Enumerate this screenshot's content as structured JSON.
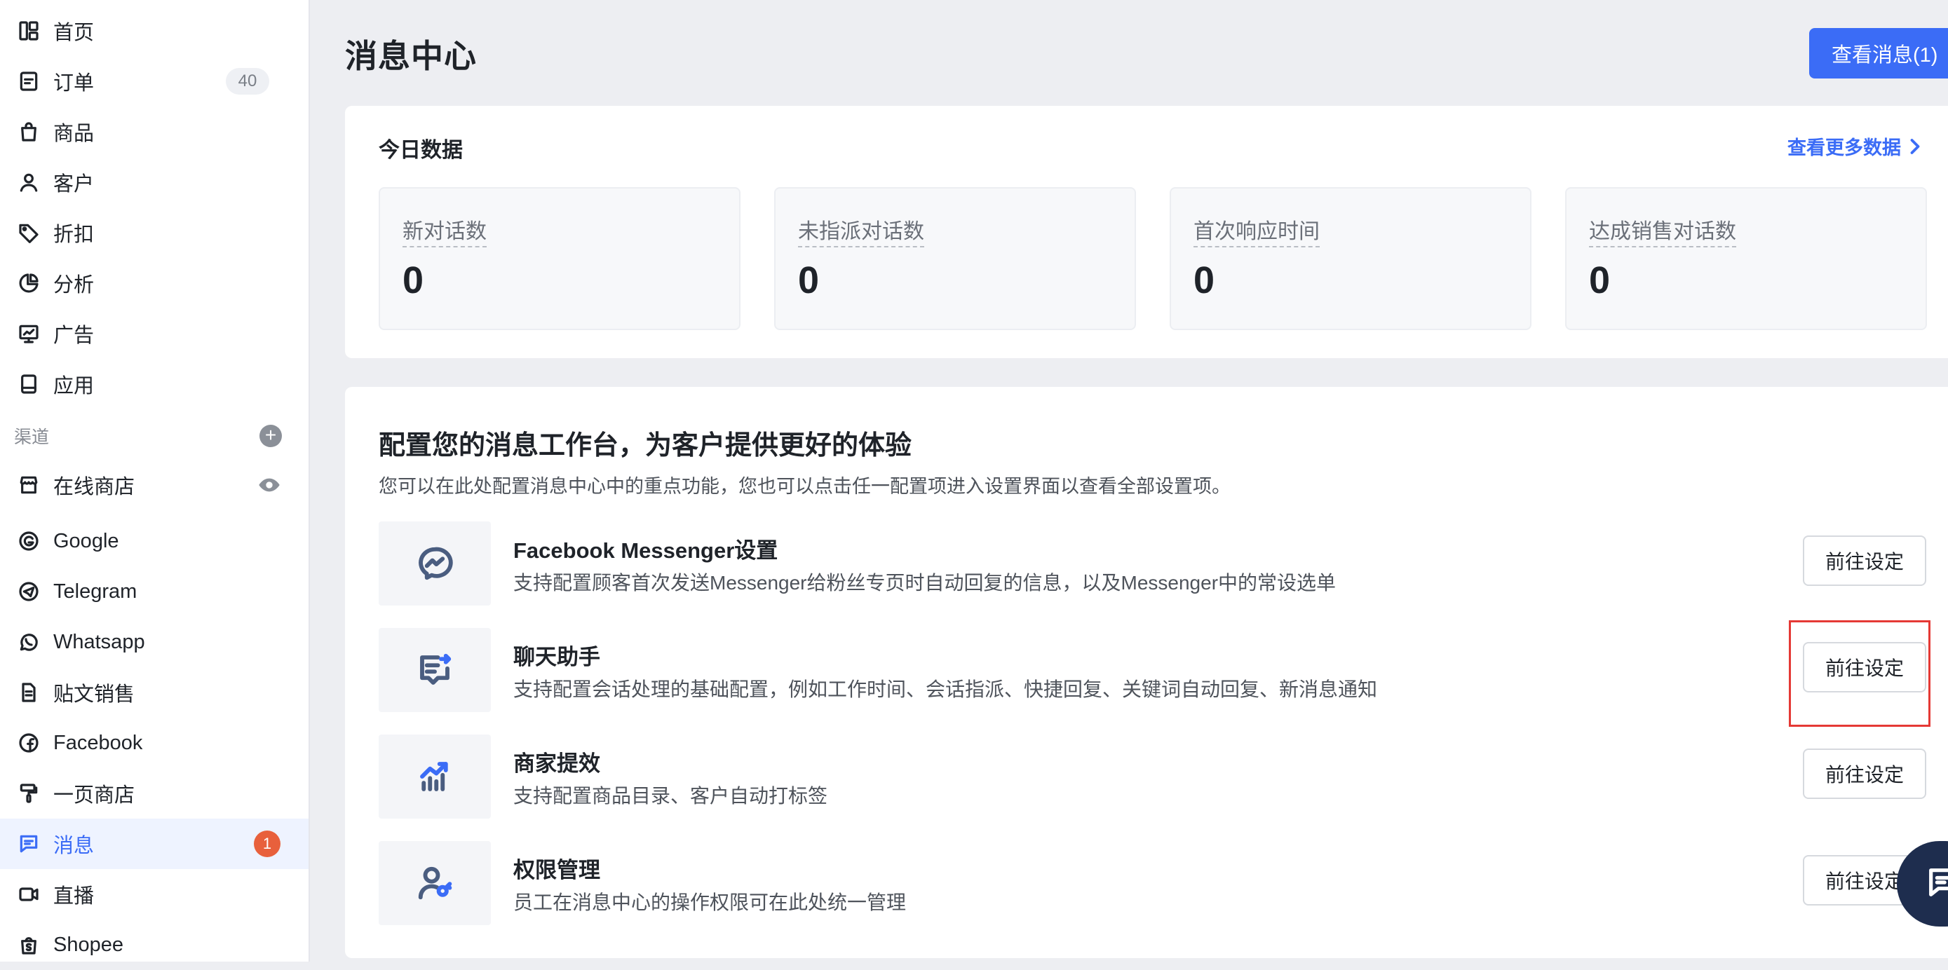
{
  "sidebar": {
    "items": [
      {
        "label": "首页",
        "icon": "dashboard-icon"
      },
      {
        "label": "订单",
        "icon": "order-icon",
        "count": "40"
      },
      {
        "label": "商品",
        "icon": "bag-icon"
      },
      {
        "label": "客户",
        "icon": "user-icon"
      },
      {
        "label": "折扣",
        "icon": "tag-icon"
      },
      {
        "label": "分析",
        "icon": "pie-chart-icon"
      },
      {
        "label": "广告",
        "icon": "monitor-icon"
      },
      {
        "label": "应用",
        "icon": "app-icon"
      }
    ],
    "section_label": "渠道",
    "channels": [
      {
        "label": "在线商店",
        "icon": "store-icon"
      },
      {
        "label": "Google",
        "icon": "google-icon"
      },
      {
        "label": "Telegram",
        "icon": "telegram-icon"
      },
      {
        "label": "Whatsapp",
        "icon": "whatsapp-icon"
      },
      {
        "label": "贴文销售",
        "icon": "document-icon"
      },
      {
        "label": "Facebook",
        "icon": "facebook-icon"
      },
      {
        "label": "一页商店",
        "icon": "brush-icon"
      },
      {
        "label": "消息",
        "icon": "message-icon",
        "badge": "1",
        "active": true
      },
      {
        "label": "直播",
        "icon": "video-icon"
      },
      {
        "label": "Shopee",
        "icon": "shopee-icon"
      }
    ]
  },
  "header": {
    "title": "消息中心",
    "view_messages_label": "查看消息(1)"
  },
  "today": {
    "title": "今日数据",
    "more_link": "查看更多数据",
    "stats": [
      {
        "label": "新对话数",
        "value": "0"
      },
      {
        "label": "未指派对话数",
        "value": "0"
      },
      {
        "label": "首次响应时间",
        "value": "0"
      },
      {
        "label": "达成销售对话数",
        "value": "0"
      }
    ]
  },
  "config": {
    "title": "配置您的消息工作台，为客户提供更好的体验",
    "description": "您可以在此处配置消息中心中的重点功能，您也可以点击任一配置项进入设置界面以查看全部设置项。",
    "items": [
      {
        "name": "Facebook Messenger设置",
        "desc": "支持配置顾客首次发送Messenger给粉丝专页时自动回复的信息，以及Messenger中的常设选单",
        "button": "前往设定",
        "icon": "messenger-icon"
      },
      {
        "name": "聊天助手",
        "desc": "支持配置会话处理的基础配置，例如工作时间、会话指派、快捷回复、关键词自动回复、新消息通知",
        "button": "前往设定",
        "icon": "chat-assistant-icon"
      },
      {
        "name": "商家提效",
        "desc": "支持配置商品目录、客户自动打标签",
        "button": "前往设定",
        "icon": "growth-chart-icon"
      },
      {
        "name": "权限管理",
        "desc": "员工在消息中心的操作权限可在此处统一管理",
        "button": "前往设定",
        "icon": "user-key-icon"
      }
    ]
  },
  "colors": {
    "accent": "#3b6cf6",
    "badge": "#e8603c",
    "highlight": "#e53935",
    "fab": "#1e2d4e"
  }
}
